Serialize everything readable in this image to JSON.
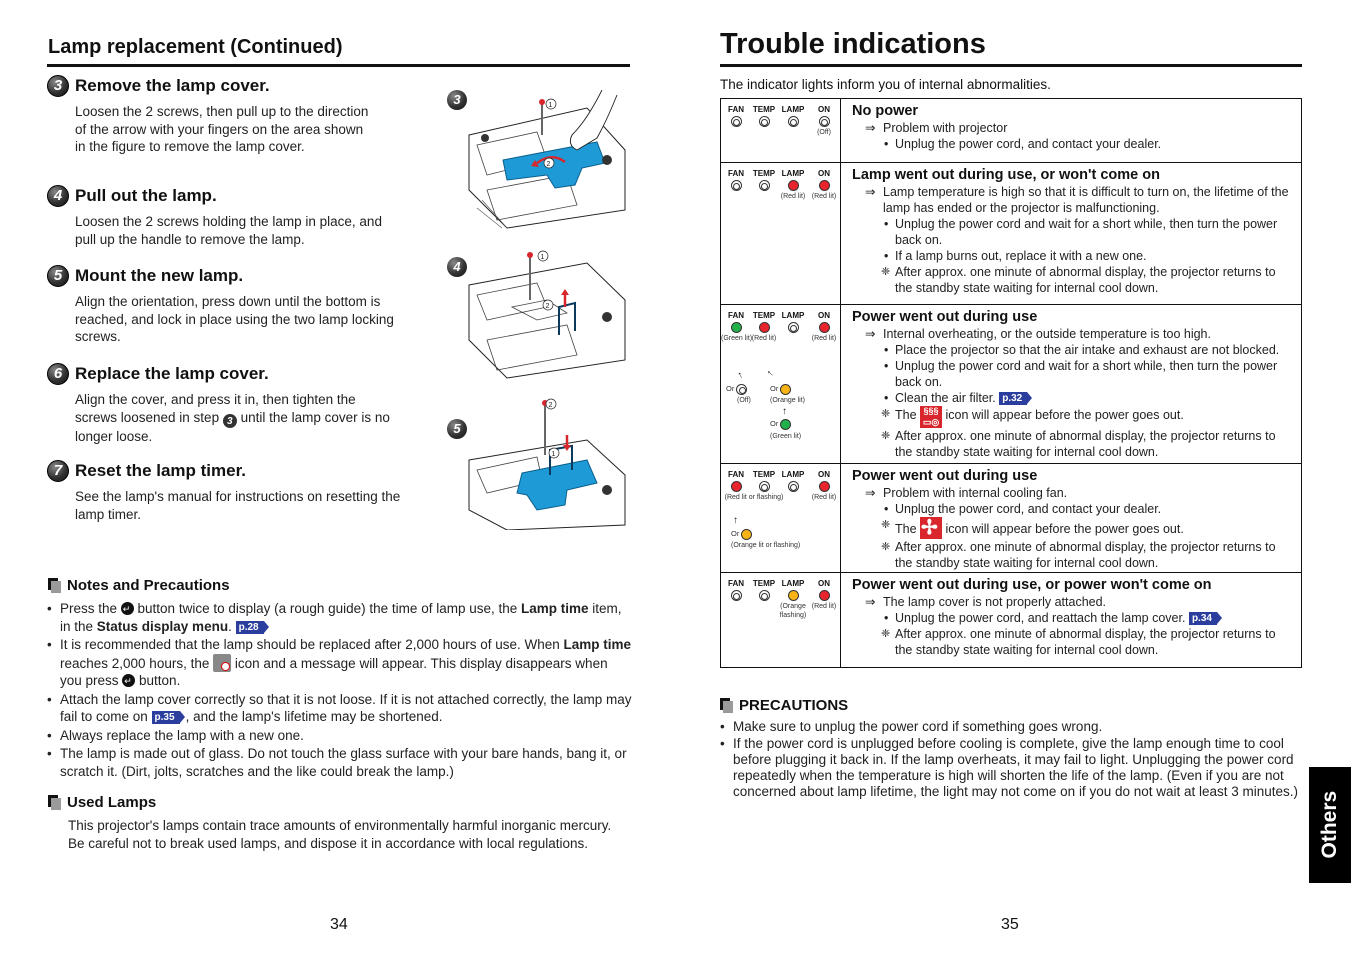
{
  "left_page": {
    "title": "Lamp replacement (Continued)",
    "steps": [
      {
        "num": "3",
        "title": "Remove the lamp cover.",
        "body": "Loosen the 2 screws, then pull up to the direction of the arrow with your fingers on the area shown in the figure to remove the lamp cover."
      },
      {
        "num": "4",
        "title": "Pull out the lamp.",
        "body": "Loosen the 2 screws holding the lamp in place, and pull up the handle to remove the lamp."
      },
      {
        "num": "5",
        "title": "Mount the new lamp.",
        "body": "Align the orientation, press down until the bottom is reached, and lock in place using the two lamp locking screws."
      },
      {
        "num": "6",
        "title": "Replace the lamp cover.",
        "body_before": "Align the cover, and press it in, then tighten the screws loosened in step ",
        "body_step_ref": "3",
        "body_after": " until the lamp cover is no longer loose."
      },
      {
        "num": "7",
        "title": "Reset the lamp timer.",
        "body": "See the lamp's manual for instructions on resetting the lamp timer."
      }
    ],
    "figures": [
      {
        "label": "3",
        "callouts": [
          "①",
          "②"
        ]
      },
      {
        "label": "4",
        "callouts": [
          "①",
          "②"
        ]
      },
      {
        "label": "5",
        "callouts": [
          "②",
          "①"
        ]
      }
    ],
    "notes": {
      "heading": "Notes and Precautions",
      "items": [
        {
          "t1": "Press the ",
          "t2": " button twice to display (a rough guide) the time of lamp use, the ",
          "b1": "Lamp time",
          "t3": " item, in the ",
          "b2": "Status display menu",
          "t4": ". ",
          "ref": "p.28"
        },
        {
          "t1": "It is recommended that the lamp should be replaced after 2,000 hours of use. When ",
          "b1": "Lamp time",
          "t2": " reaches 2,000 hours, the ",
          "t3": " icon and a message will appear. This display disappears when you press ",
          "t4": " button."
        },
        {
          "t1": "Attach the lamp cover correctly so that it is not loose. If it is not attached correctly, the lamp may fail to come on ",
          "ref": "p.35",
          "t2": ", and the lamp's lifetime may be shortened."
        },
        {
          "t1": "Always replace the lamp with a new one."
        },
        {
          "t1": "The lamp is made out of glass. Do not touch the glass surface with your bare hands, bang it, or scratch it. (Dirt, jolts, scratches and the like could break the lamp.)"
        }
      ]
    },
    "used_lamps": {
      "heading": "Used Lamps",
      "body": "This projector's lamps contain trace amounts of environmentally harmful inorganic mercury. Be careful not to break used lamps, and dispose it in accordance with local regulations."
    },
    "page_number": "34"
  },
  "right_page": {
    "title": "Trouble indications",
    "intro": "The indicator lights inform you of internal abnormalities.",
    "led_names": [
      "FAN",
      "TEMP",
      "LAMP",
      "ON"
    ],
    "rows": [
      {
        "leds": [
          "off",
          "off",
          "off",
          "off"
        ],
        "led_notes": [
          "",
          "",
          "",
          "(Off)"
        ],
        "title": "No power",
        "cause": "Problem with projector",
        "actions": [
          {
            "type": "bullet",
            "text": "Unplug the power cord, and contact your dealer."
          }
        ]
      },
      {
        "leds": [
          "off",
          "off",
          "red",
          "red"
        ],
        "led_notes": [
          "",
          "",
          "(Red lit)",
          "(Red lit)"
        ],
        "title": "Lamp went out during use, or won't come on",
        "cause": "Lamp temperature is high so that it is difficult to turn on, the lifetime of the lamp has ended or the projector is malfunctioning.",
        "actions": [
          {
            "type": "bullet",
            "text": "Unplug the power cord and wait for a short while, then turn the power back on."
          },
          {
            "type": "bullet",
            "text": "If a lamp burns out, replace it with a new one."
          },
          {
            "type": "note",
            "text": "After approx. one minute of abnormal display, the projector returns to the standby state waiting for internal cool down."
          }
        ]
      },
      {
        "leds": [
          "green",
          "red",
          "off",
          "red"
        ],
        "led_notes": [
          "(Green lit)",
          "(Red lit)",
          "",
          "(Red lit)"
        ],
        "alternatives": {
          "or_label": "Or",
          "fan_alt": "(Off)",
          "temp_alt1": "(Orange lit)",
          "temp_alt2": "(Green lit)"
        },
        "title": "Power went out during use",
        "cause": "Internal overheating, or the outside temperature is too high.",
        "actions": [
          {
            "type": "bullet",
            "text": "Place the projector so that the air intake and exhaust are not blocked."
          },
          {
            "type": "bullet",
            "text": "Unplug the power cord and wait for a short while, then turn the power back on."
          },
          {
            "type": "bullet",
            "text": "Clean the air filter.",
            "ref": "p.32"
          },
          {
            "type": "note",
            "pre": "The ",
            "icon": "temperature-warning-icon",
            "post": " icon will appear before the power goes out."
          },
          {
            "type": "note",
            "text": "After approx. one minute of abnormal display, the projector returns to the standby state waiting for internal cool down."
          }
        ]
      },
      {
        "leds": [
          "red",
          "off",
          "off",
          "red"
        ],
        "led_notes": [
          "(Red lit or flashing)",
          "",
          "",
          "(Red lit)"
        ],
        "alternatives": {
          "or_label": "Or",
          "fan_alt": "(Orange lit or flashing)"
        },
        "title": "Power went out during use",
        "cause": "Problem with internal cooling fan.",
        "actions": [
          {
            "type": "bullet",
            "text": "Unplug the power cord, and contact your dealer."
          },
          {
            "type": "note",
            "pre": "The ",
            "icon": "fan-warning-icon",
            "post": " icon will appear before the power goes out."
          },
          {
            "type": "note",
            "text": "After approx. one minute of abnormal display, the projector returns to the standby state waiting for internal cool down."
          }
        ]
      },
      {
        "leds": [
          "off",
          "off",
          "orange",
          "red"
        ],
        "led_notes": [
          "",
          "",
          "(Orange flashing)",
          "(Red lit)"
        ],
        "title": "Power went out during use, or power won't come on",
        "cause": "The lamp cover is not properly attached.",
        "actions": [
          {
            "type": "bullet",
            "text": "Unplug the power cord, and reattach the lamp cover.",
            "ref": "p.34"
          },
          {
            "type": "note",
            "text": "After approx. one minute of abnormal display, the projector returns to the standby state waiting for internal cool down."
          }
        ]
      }
    ],
    "precautions": {
      "heading": "PRECAUTIONS",
      "items": [
        "Make sure to unplug the power cord if something goes wrong.",
        "If the power cord is unplugged before cooling is complete, give the lamp enough time to cool before plugging it back in. If the lamp overheats, it may fail to light. Unplugging the power cord repeatedly when the temperature is high will shorten the life of the lamp. (Even if you are not concerned about lamp lifetime, the light may not come on if you do not wait at least 3 minutes.)"
      ]
    },
    "page_number": "35",
    "side_tab": "Others"
  },
  "colors": {
    "led_red": "#e8242c",
    "led_green": "#22b04a",
    "led_orange": "#f8b416",
    "page_ref_blue": "#2b3e9e",
    "lamp_part_blue": "#1e9bd7",
    "warning_icon_red": "#d9262c"
  }
}
